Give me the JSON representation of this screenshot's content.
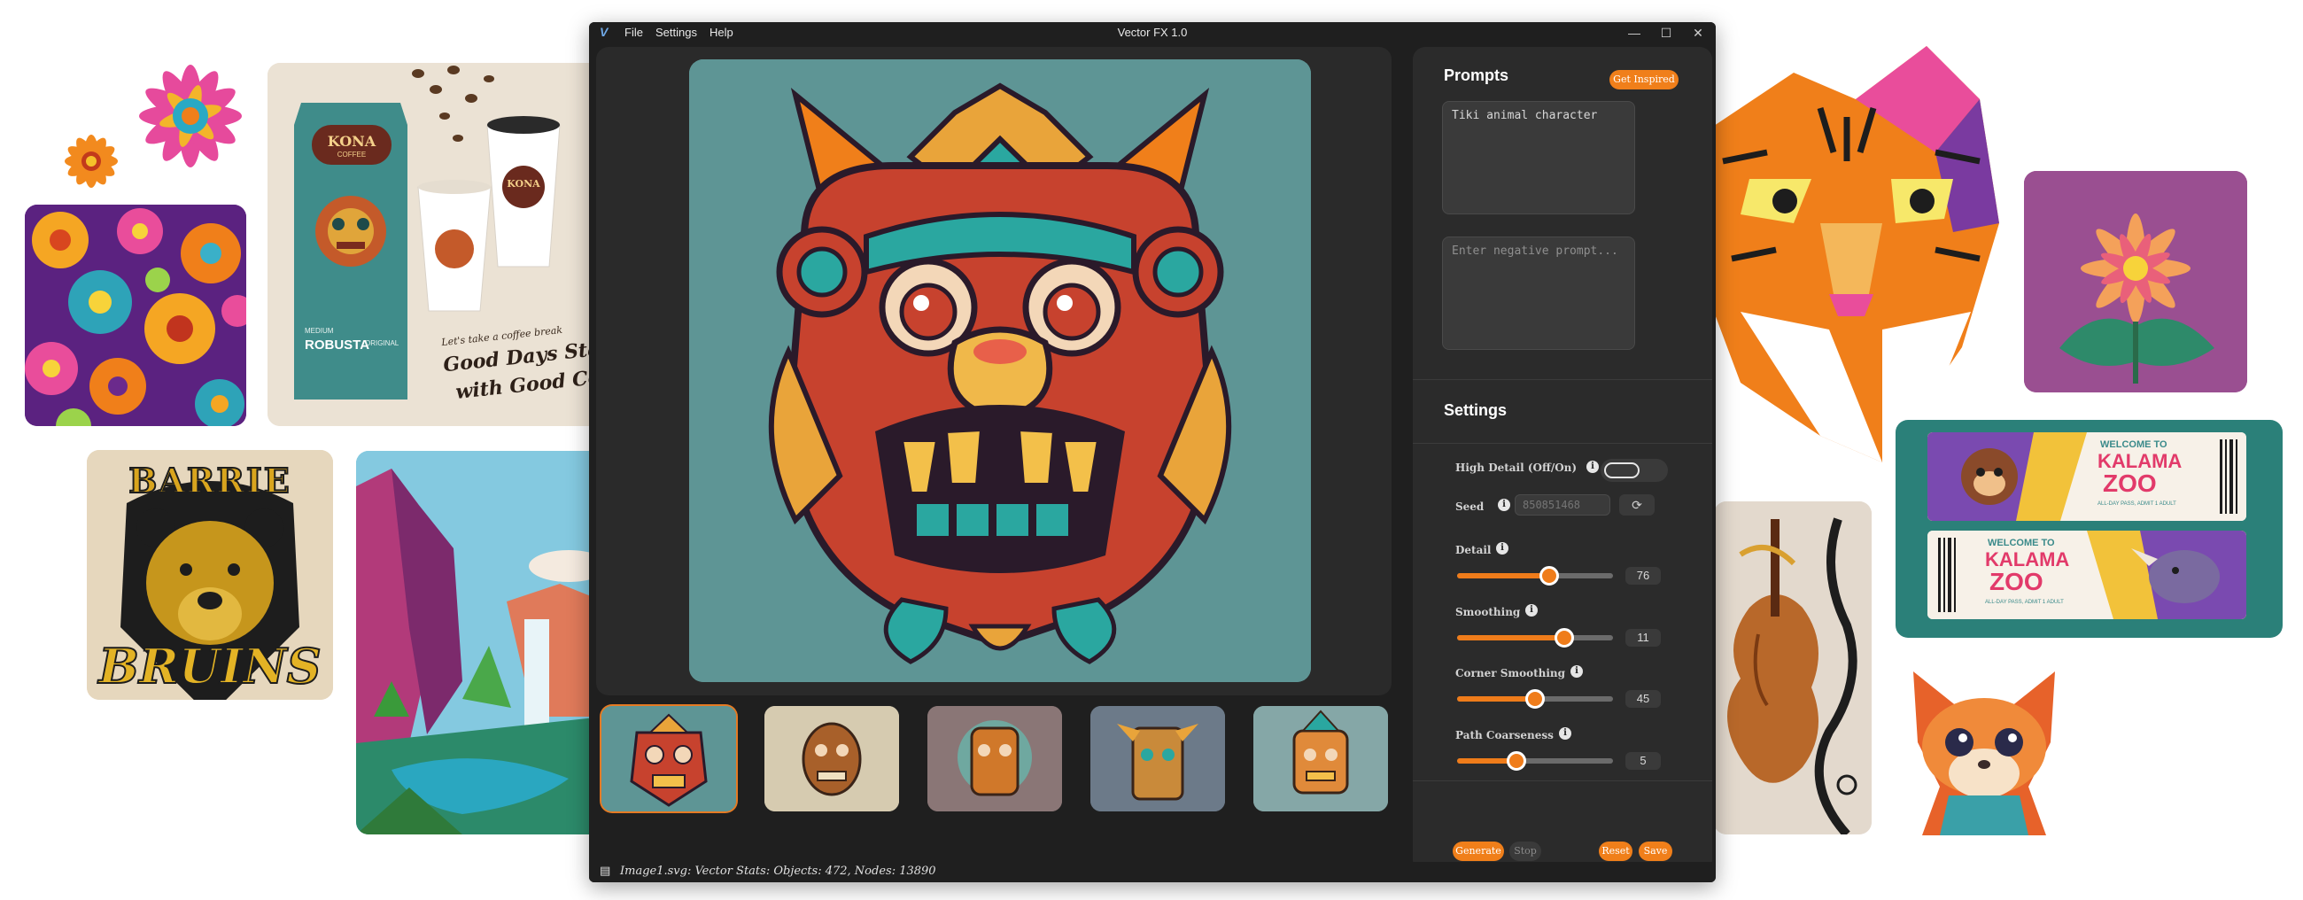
{
  "window": {
    "title": "Vector FX 1.0",
    "app_logo": "V"
  },
  "menu": [
    "File",
    "Settings",
    "Help"
  ],
  "window_controls": {
    "minimize": "—",
    "maximize": "☐",
    "close": "✕"
  },
  "prompts": {
    "heading": "Prompts",
    "inspire_label": "Get Inspired",
    "prompt_value": "Tiki animal character",
    "negative_placeholder": "Enter negative prompt..."
  },
  "settings": {
    "heading": "Settings",
    "high_detail_label": "High Detail (Off/On)",
    "high_detail_on": false,
    "seed_label": "Seed",
    "seed_placeholder": "850851468",
    "sliders": [
      {
        "label": "Detail",
        "value": "76",
        "fraction": 0.59
      },
      {
        "label": "Smoothing",
        "value": "11",
        "fraction": 0.69
      },
      {
        "label": "Corner Smoothing",
        "value": "45",
        "fraction": 0.5
      },
      {
        "label": "Path Coarseness",
        "value": "5",
        "fraction": 0.38
      }
    ]
  },
  "actions": {
    "generate": "Generate",
    "stop": "Stop",
    "reset": "Reset",
    "save": "Save"
  },
  "status": {
    "text": "Image1.svg: Vector Stats: Objects: 472, Nodes: 13890"
  },
  "showcase": {
    "coffee": {
      "brand": "KONA",
      "brand_sub": "COFFEE",
      "roast": "MEDIUM",
      "variety": "ROBUSTA",
      "origin_label": "ORIGINAL",
      "tagline_small": "Let's take a coffee break",
      "tagline_1": "Good Days Start",
      "tagline_2": "with Good Coffee"
    },
    "bear": {
      "top": "BARRIE",
      "bottom": "BRUINS"
    },
    "zoo": {
      "welcome": "WELCOME TO",
      "name1": "KALAMA",
      "name2": "ZOO",
      "pass": "ALL-DAY PASS, ADMIT 1 ADULT"
    }
  },
  "colors": {
    "accent": "#f07f1a",
    "panel": "#2b2b2b",
    "canvas_bg": "#5e9494"
  }
}
